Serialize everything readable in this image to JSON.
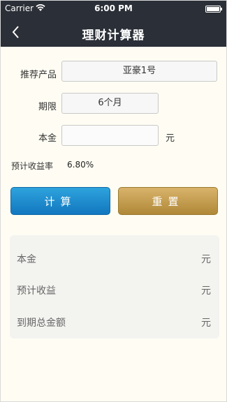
{
  "status_bar": {
    "carrier": "Carrier",
    "time": "6:00 PM"
  },
  "navbar": {
    "title": "理财计算器",
    "back_icon": "chevron-left-icon"
  },
  "form": {
    "product_label": "推荐产品",
    "product_value": "亚豪1号",
    "term_label": "期限",
    "term_value": "6个月",
    "principal_label": "本金",
    "principal_value": "",
    "principal_unit": "元",
    "rate_label": "预计收益率",
    "rate_value": "6.80%"
  },
  "buttons": {
    "calculate": "计算",
    "reset": "重置"
  },
  "results": [
    {
      "label": "本金",
      "unit": "元"
    },
    {
      "label": "预计收益",
      "unit": "元"
    },
    {
      "label": "到期总金额",
      "unit": "元"
    }
  ],
  "colors": {
    "nav_bg": "#2b2f37",
    "page_bg": "#fffdf3",
    "calc_button": "#1f8fd1",
    "reset_button": "#c49d50",
    "result_panel": "#f3f3f0"
  }
}
